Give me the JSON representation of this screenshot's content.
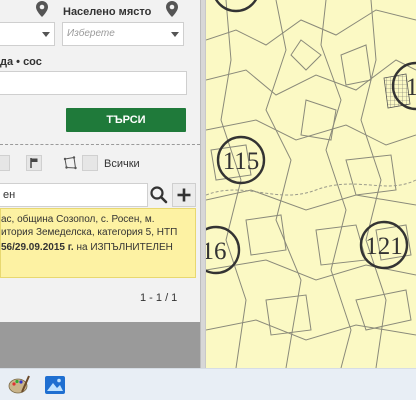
{
  "panel": {
    "settlement_label": "Населено място",
    "settlement_placeholder": "Изберете",
    "code_label": "да • сос",
    "search_button": "ТЪРСИ",
    "all_label": "Всички",
    "filter_value": "ен",
    "result": {
      "line1": "ас, община Созопол, с. Росен, м.",
      "line2": "итория Земеделска, категория 5, НТП",
      "line3_bold": "56/29.09.2015 г.",
      "line3_rest": " на ИЗПЪЛНИТЕЛЕН"
    },
    "pager": "1 - 1 / 1"
  },
  "map": {
    "parcel_labels": [
      "115",
      "121",
      "16",
      "1"
    ]
  },
  "colors": {
    "accent_green": "#1f7a3a",
    "result_bg": "#fdf2a3",
    "map_bg": "#fbf9c4"
  },
  "icons": [
    "location-pin-icon",
    "dropdown-caret-icon",
    "search-icon",
    "plus-icon",
    "flag-icon",
    "polygon-icon",
    "paint-palette-icon",
    "photos-app-icon"
  ]
}
